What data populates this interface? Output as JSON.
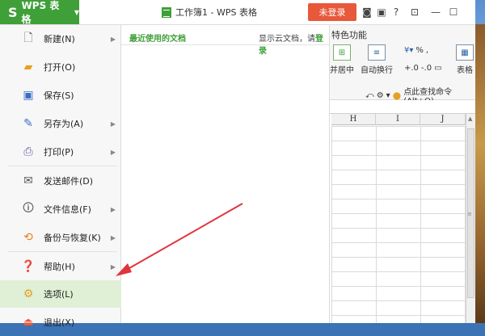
{
  "titlebar": {
    "app_label": "WPS 表格",
    "app_logo": "S",
    "document_title": "工作簿1 - WPS 表格",
    "login_label": "未登录"
  },
  "ribbon": {
    "tab_fragment": "特色功能",
    "merge_center": "并居中",
    "wrap_text": "自动换行",
    "percent": "%",
    "table_style": "表格",
    "find_command": "点此查找命令 (Alt+Q)",
    "dec_increase": "+.0",
    "dec_decrease": "-.0"
  },
  "sheet": {
    "columns": [
      "H",
      "I",
      "J"
    ]
  },
  "menu": {
    "items": [
      {
        "label": "新建(N)",
        "icon": "new-file-icon",
        "has_submenu": true
      },
      {
        "label": "打开(O)",
        "icon": "folder-open-icon",
        "has_submenu": false
      },
      {
        "label": "保存(S)",
        "icon": "save-icon",
        "has_submenu": false
      },
      {
        "label": "另存为(A)",
        "icon": "save-as-icon",
        "has_submenu": true
      },
      {
        "label": "打印(P)",
        "icon": "printer-icon",
        "has_submenu": true
      },
      {
        "label": "发送邮件(D)",
        "icon": "mail-icon",
        "has_submenu": false
      },
      {
        "label": "文件信息(F)",
        "icon": "file-info-icon",
        "has_submenu": true
      },
      {
        "label": "备份与恢复(K)",
        "icon": "backup-icon",
        "has_submenu": true
      },
      {
        "label": "帮助(H)",
        "icon": "help-icon",
        "has_submenu": true
      },
      {
        "label": "选项(L)",
        "icon": "gear-icon",
        "has_submenu": false
      },
      {
        "label": "退出(X)",
        "icon": "exit-icon",
        "has_submenu": false
      }
    ],
    "selected_index": 9
  },
  "recent": {
    "title": "最近使用的文档",
    "cloud_prefix": "显示云文档，请",
    "cloud_link": "登录"
  },
  "colors": {
    "brand_green": "#3f9f38",
    "login_red": "#e8583a",
    "selected_bg": "#dff0d6",
    "annotation_arrow": "#e0343c"
  }
}
